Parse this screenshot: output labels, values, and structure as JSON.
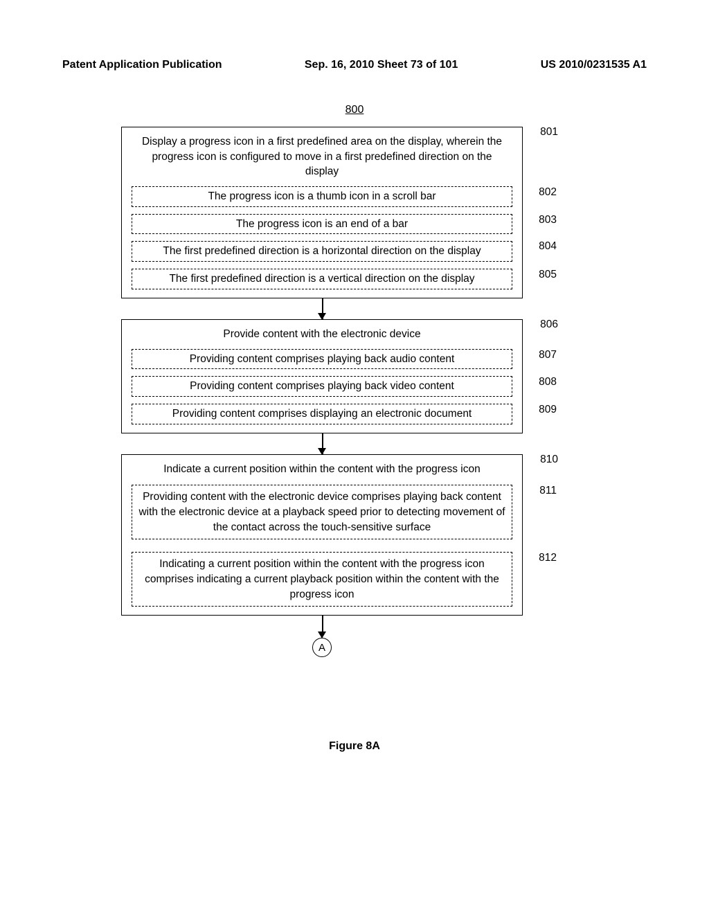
{
  "header": {
    "left": "Patent Application Publication",
    "center": "Sep. 16, 2010  Sheet 73 of 101",
    "right": "US 2010/0231535 A1"
  },
  "figure": {
    "ref": "800",
    "caption": "Figure 8A",
    "connector": "A",
    "boxes": [
      {
        "ref": "801",
        "main": "Display a progress icon in a first predefined area on the display, wherein the progress icon is configured to move in a first predefined direction on the display",
        "subs": [
          {
            "ref": "802",
            "text": "The progress icon is a thumb icon in a scroll bar"
          },
          {
            "ref": "803",
            "text": "The progress icon is an end of a bar"
          },
          {
            "ref": "804",
            "text": "The first predefined direction is a horizontal direction on the display"
          },
          {
            "ref": "805",
            "text": "The first predefined direction is a vertical direction on the display"
          }
        ]
      },
      {
        "ref": "806",
        "main": "Provide content with the electronic device",
        "subs": [
          {
            "ref": "807",
            "text": "Providing content comprises playing back audio content"
          },
          {
            "ref": "808",
            "text": "Providing content comprises playing back video content"
          },
          {
            "ref": "809",
            "text": "Providing content comprises displaying an electronic document"
          }
        ]
      },
      {
        "ref": "810",
        "main": "Indicate a current position within the content with the progress icon",
        "subs": [
          {
            "ref": "811",
            "text": "Providing content with the electronic device comprises playing back content with the electronic device at a playback speed prior to detecting movement of the contact across the touch-sensitive surface",
            "tall": true
          },
          {
            "ref": "812",
            "text": "Indicating a current position within the content with the progress icon comprises indicating a current playback position within the content with the progress icon",
            "tall": true
          }
        ]
      }
    ]
  }
}
